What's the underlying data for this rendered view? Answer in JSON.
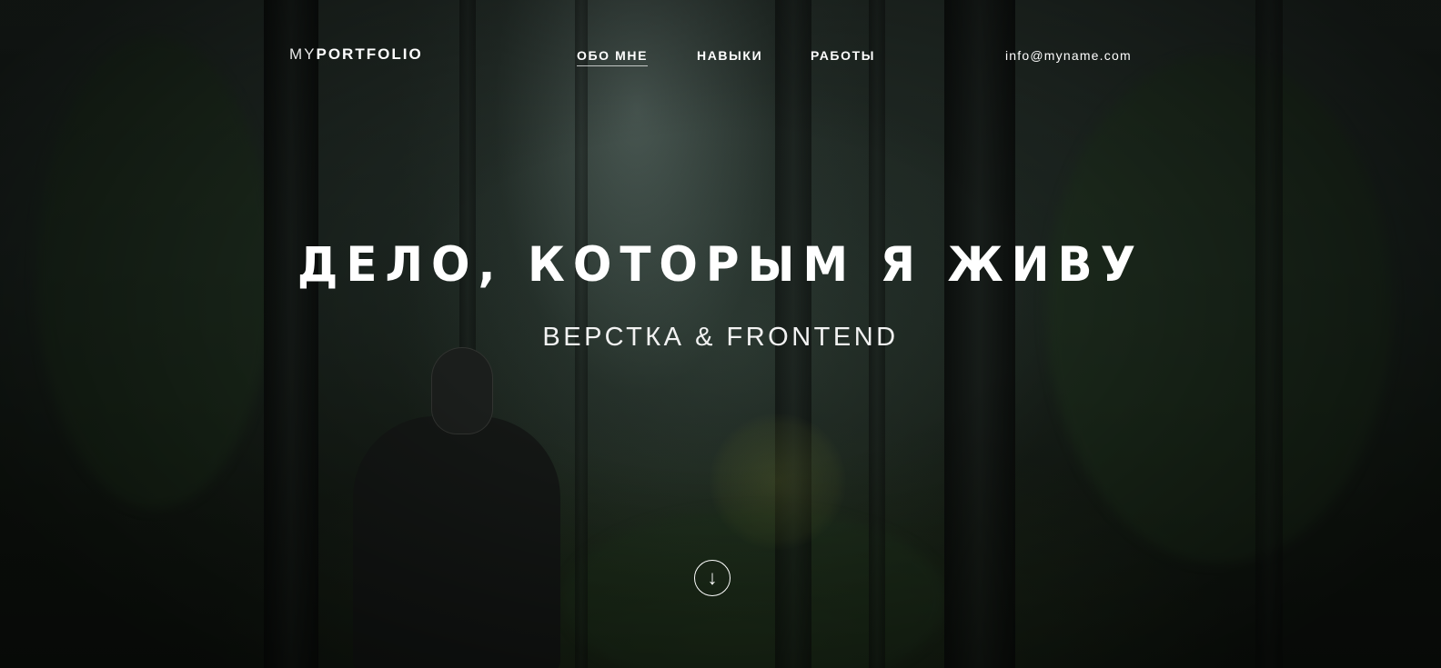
{
  "header": {
    "logo_light": "MY",
    "logo_bold": "PORTFOLIO",
    "nav": [
      {
        "label": "ОБО МНЕ",
        "active": true
      },
      {
        "label": "НАВЫКИ",
        "active": false
      },
      {
        "label": "РАБОТЫ",
        "active": false
      }
    ],
    "email": "info@myname.com"
  },
  "hero": {
    "title": "ДЕЛО, КОТОРЫМ Я ЖИВУ",
    "subtitle": "ВЕРСТКА & FRONTEND",
    "scroll_icon": "arrow-down-icon",
    "scroll_glyph": "↓"
  },
  "colors": {
    "text": "#ffffff",
    "background": "#1b241f"
  }
}
